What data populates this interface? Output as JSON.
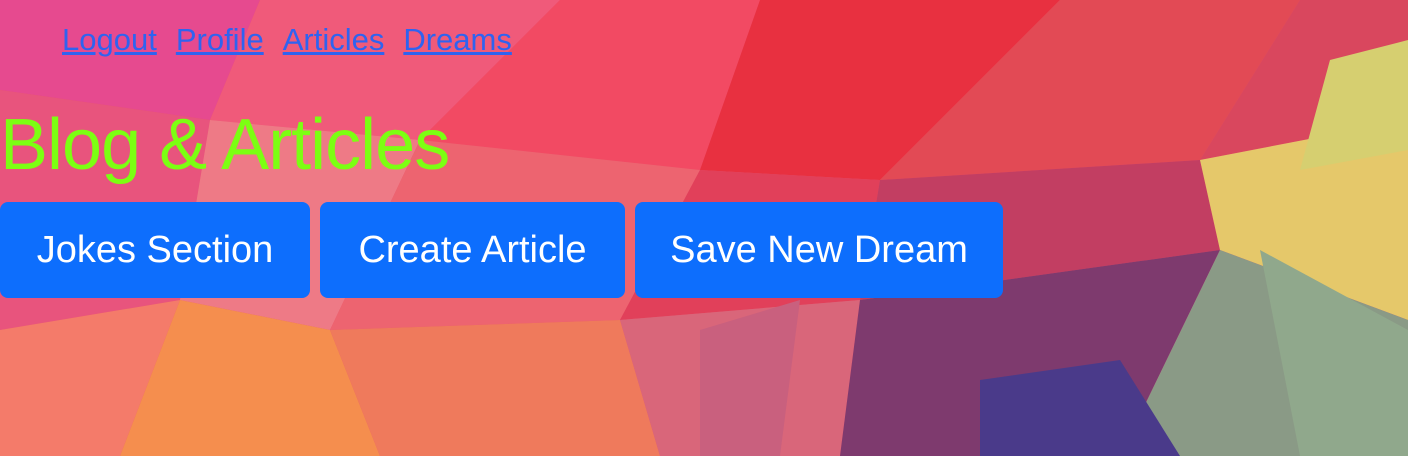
{
  "nav": {
    "links": [
      {
        "label": "Logout"
      },
      {
        "label": "Profile"
      },
      {
        "label": "Articles"
      },
      {
        "label": "Dreams"
      }
    ]
  },
  "page": {
    "title": "Blog & Articles"
  },
  "actions": {
    "jokes_label": "Jokes Section",
    "create_label": "Create Article",
    "dream_label": "Save New Dream"
  },
  "colors": {
    "title": "#7cff12",
    "button_bg": "#0d6efd",
    "button_text": "#ffffff",
    "link": "#2f63f0"
  }
}
